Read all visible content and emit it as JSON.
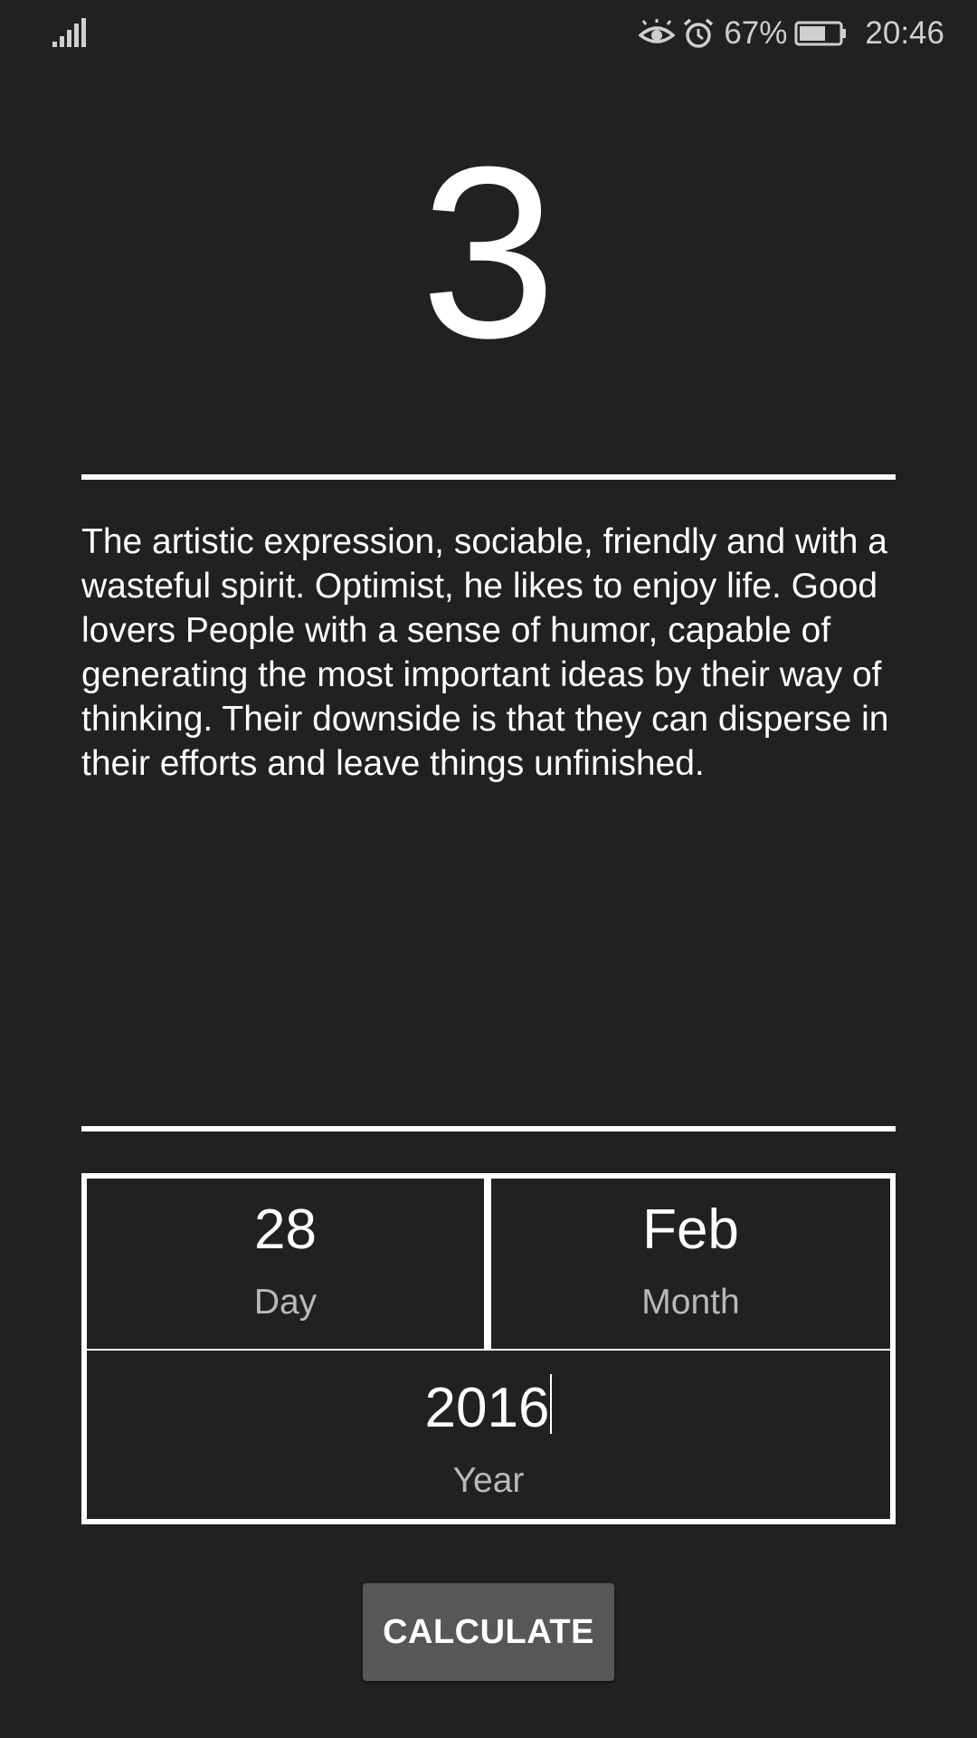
{
  "status_bar": {
    "signal_icon": "signal-bars-icon",
    "eye_icon": "eye-comfort-icon",
    "alarm_icon": "alarm-clock-icon",
    "battery_percent": "67%",
    "battery_level": 0.67,
    "time": "20:46"
  },
  "result": {
    "number": "3",
    "description": "The artistic expression, sociable, friendly and with a wasteful spirit. Optimist, he likes to enjoy life. Good lovers People with a sense of humor, capable of generating the most important ideas by their way of thinking. Their downside is that they can disperse in their efforts and leave things unfinished."
  },
  "date_input": {
    "day_value": "28",
    "day_label": "Day",
    "month_value": "Feb",
    "month_label": "Month",
    "year_value": "2016",
    "year_label": "Year"
  },
  "actions": {
    "calculate_label": "CALCULATE"
  },
  "colors": {
    "background": "#212121",
    "button": "#575757",
    "text": "#ffffff",
    "label": "#b9b9b9"
  }
}
